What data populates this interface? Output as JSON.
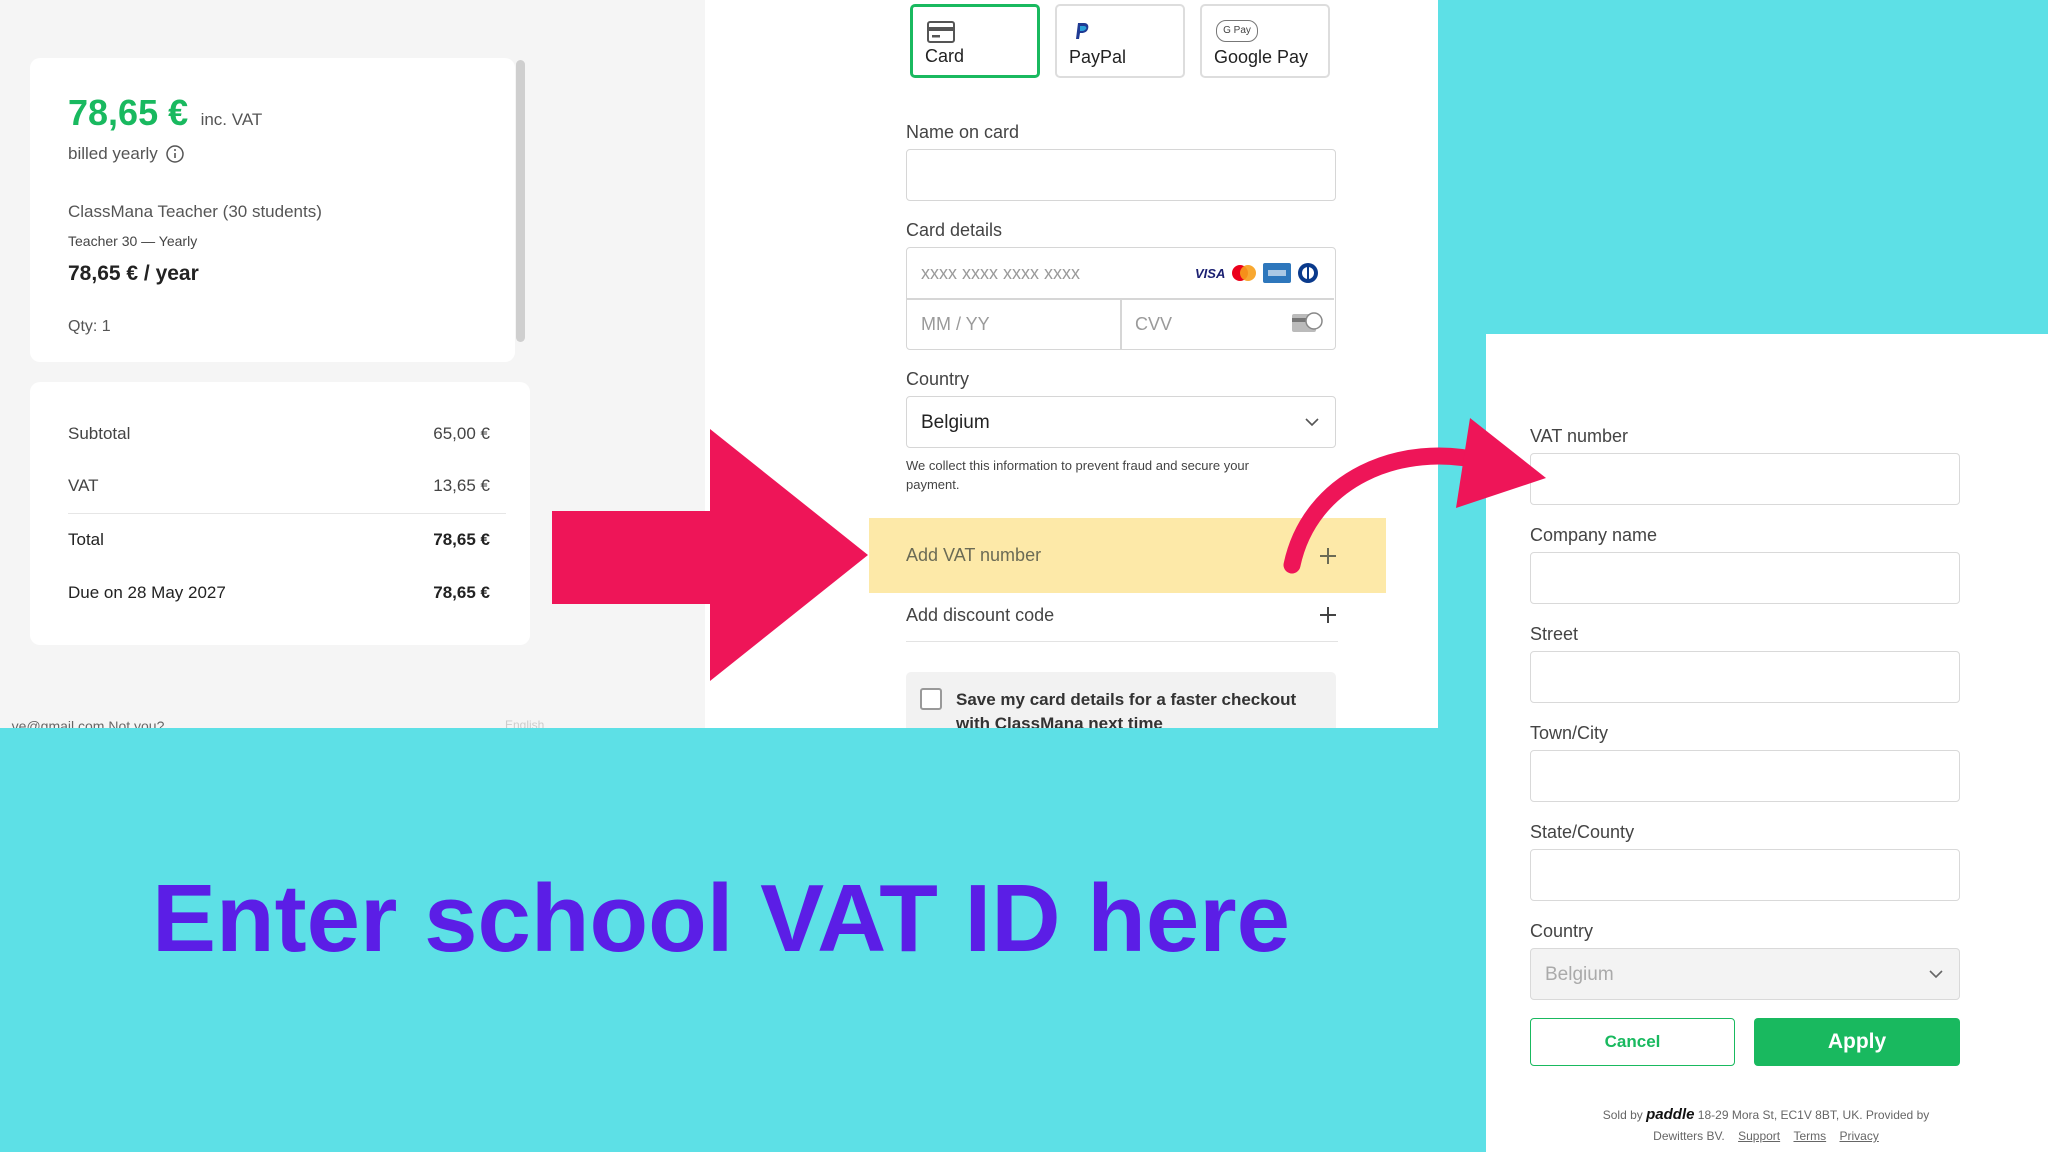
{
  "summary": {
    "price": "78,65 €",
    "price_suffix": "inc. VAT",
    "billing_note": "billed yearly",
    "product_name": "ClassMana Teacher (30 students)",
    "plan_name": "Teacher 30 — Yearly",
    "plan_price": "78,65 € / year",
    "quantity": "Qty: 1",
    "rows": [
      {
        "label": "Subtotal",
        "value": "65,00 €"
      },
      {
        "label": "VAT",
        "value": "13,65 €"
      },
      {
        "label": "Total",
        "value": "78,65 €"
      },
      {
        "label": "Due on 28 May 2027",
        "value": "78,65 €"
      }
    ],
    "account_text": "...ve@gmail.com   Not you?",
    "language": "English"
  },
  "payment": {
    "tabs": [
      {
        "label": "Card",
        "icon": "card-icon"
      },
      {
        "label": "PayPal",
        "icon": "paypal-icon"
      },
      {
        "label": "Google Pay",
        "icon": "google-pay-icon",
        "badge": "G Pay"
      }
    ],
    "name_label": "Name on card",
    "name_value": "",
    "card_label": "Card details",
    "card_number_placeholder": "xxxx xxxx xxxx xxxx",
    "brand_visa": "VISA",
    "expiry_placeholder": "MM / YY",
    "cvv_placeholder": "CVV",
    "country_label": "Country",
    "country_value": "Belgium",
    "info_note": "We collect this information to prevent fraud and secure your payment.",
    "add_vat": "Add VAT number",
    "add_discount": "Add discount code",
    "save_card": "Save my card details for a faster checkout with ClassMana next time"
  },
  "vat_form": {
    "vat_label": "VAT number",
    "company_label": "Company name",
    "street_label": "Street",
    "city_label": "Town/City",
    "state_label": "State/County",
    "country_label": "Country",
    "country_value": "Belgium",
    "cancel": "Cancel",
    "apply": "Apply",
    "footer_sold_by": "Sold by",
    "footer_brand": "paddle",
    "footer_address": "18-29 Mora St, EC1V 8BT, UK.  Provided by",
    "footer_provider": "Dewitters BV.",
    "footer_links": [
      "Support",
      "Terms",
      "Privacy"
    ]
  },
  "headline": "Enter school VAT ID here",
  "colors": {
    "background": "#5de0e6",
    "accent_green": "#19b95f",
    "arrow_pink": "#ee1558",
    "headline_purple": "#5b1ee6",
    "highlight": "#fde9a8"
  }
}
